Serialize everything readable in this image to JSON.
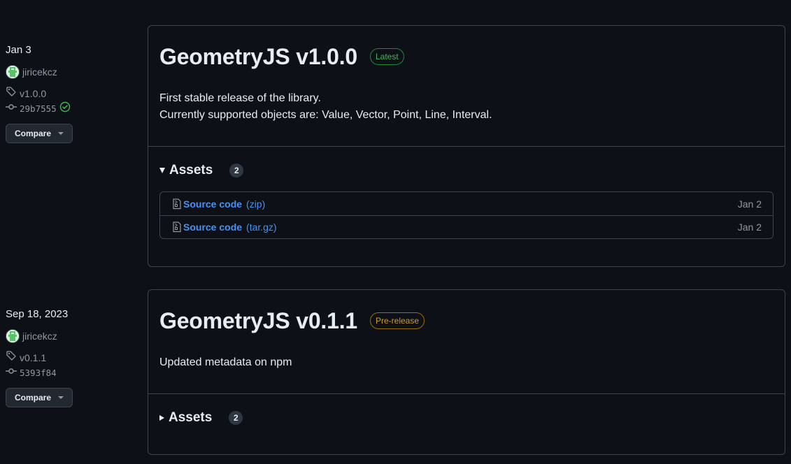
{
  "releases": [
    {
      "date": "Jan 3",
      "author": "jiricekcz",
      "tag": "v1.0.0",
      "commit": "29b7555",
      "verified": true,
      "compare_label": "Compare",
      "title": "GeometryJS v1.0.0",
      "badge": "Latest",
      "notes": [
        "First stable release of the library.",
        "Currently supported objects are: Value, Vector, Point, Line, Interval."
      ],
      "assets_label": "Assets",
      "assets_count": "2",
      "assets_expanded": true,
      "assets": [
        {
          "name": "Source code",
          "ext": "(zip)",
          "date": "Jan 2"
        },
        {
          "name": "Source code",
          "ext": "(tar.gz)",
          "date": "Jan 2"
        }
      ]
    },
    {
      "date": "Sep 18, 2023",
      "author": "jiricekcz",
      "tag": "v0.1.1",
      "commit": "5393f84",
      "verified": false,
      "compare_label": "Compare",
      "title": "GeometryJS v0.1.1",
      "badge": "Pre-release",
      "notes": [
        "Updated metadata on npm"
      ],
      "assets_label": "Assets",
      "assets_count": "2",
      "assets_expanded": false
    }
  ],
  "colors": {
    "background": "#0d1117",
    "border": "#3d444d",
    "link": "#4493f8",
    "latest": "#3fb950",
    "prerelease": "#d29922",
    "muted": "#9198a1"
  }
}
